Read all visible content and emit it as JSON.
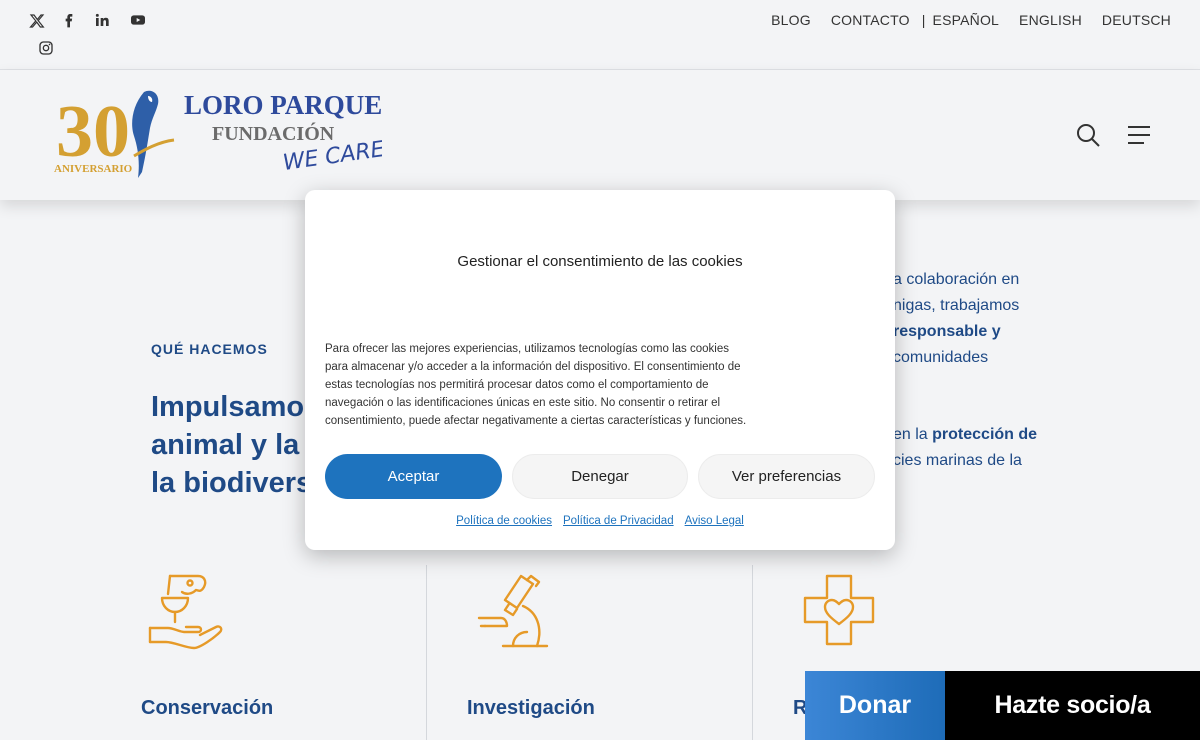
{
  "topbar": {
    "social": [
      "x-icon",
      "facebook-icon",
      "linkedin-icon",
      "youtube-icon",
      "instagram-icon"
    ],
    "links": {
      "blog": "BLOG",
      "contacto": "CONTACTO",
      "separator": "|",
      "espanol": "ESPAÑOL",
      "english": "ENGLISH",
      "deutsch": "DEUTSCH"
    }
  },
  "header": {
    "logo": {
      "number": "30",
      "anniversary": "ANIVERSARIO",
      "line1": "LORO PARQUE",
      "line2": "FUNDACIÓN",
      "line3": "WE CARE"
    },
    "icons": [
      "search-icon",
      "menu-icon"
    ]
  },
  "main": {
    "eyebrow": "QUÉ HACEMOS",
    "headline_lines": [
      "Impulsamo",
      "animal y la",
      "la biodivers"
    ],
    "right_text": {
      "p1_l1": "a colaboración en",
      "p1_l2": "nigas, trabajamos",
      "p1_l3": "responsable y",
      "p1_l4": "comunidades",
      "p2_l1_a": "en la ",
      "p2_l1_b": "protección de",
      "p2_l2": "cies marinas de la"
    },
    "features": [
      {
        "title": "Conservación",
        "icon": "parrot-hand-icon"
      },
      {
        "title": "Investigación",
        "icon": "microscope-icon"
      },
      {
        "title": "R",
        "icon": "heart-cross-icon"
      }
    ]
  },
  "cookie_modal": {
    "title": "Gestionar el consentimiento de las cookies",
    "body_lines": [
      "Para ofrecer las mejores experiencias, utilizamos tecnologías como las cookies",
      "para almacenar y/o acceder a la información del dispositivo. El consentimiento de",
      "estas tecnologías nos permitirá procesar datos como el comportamiento de",
      "navegación o las identificaciones únicas en este sitio. No consentir o retirar el",
      "consentimiento, puede afectar negativamente a ciertas características y funciones."
    ],
    "buttons": {
      "accept": "Aceptar",
      "deny": "Denegar",
      "preferences": "Ver preferencias"
    },
    "links": {
      "cookies": "Política de cookies",
      "privacy": "Política de Privacidad",
      "legal": "Aviso Legal"
    }
  },
  "cta": {
    "donate": "Donar",
    "member": "Hazte socio/a"
  },
  "colors": {
    "accent_blue": "#1e73be",
    "navy": "#1f4a86",
    "gold": "#d4a032",
    "icon_orange": "#e69a28"
  }
}
